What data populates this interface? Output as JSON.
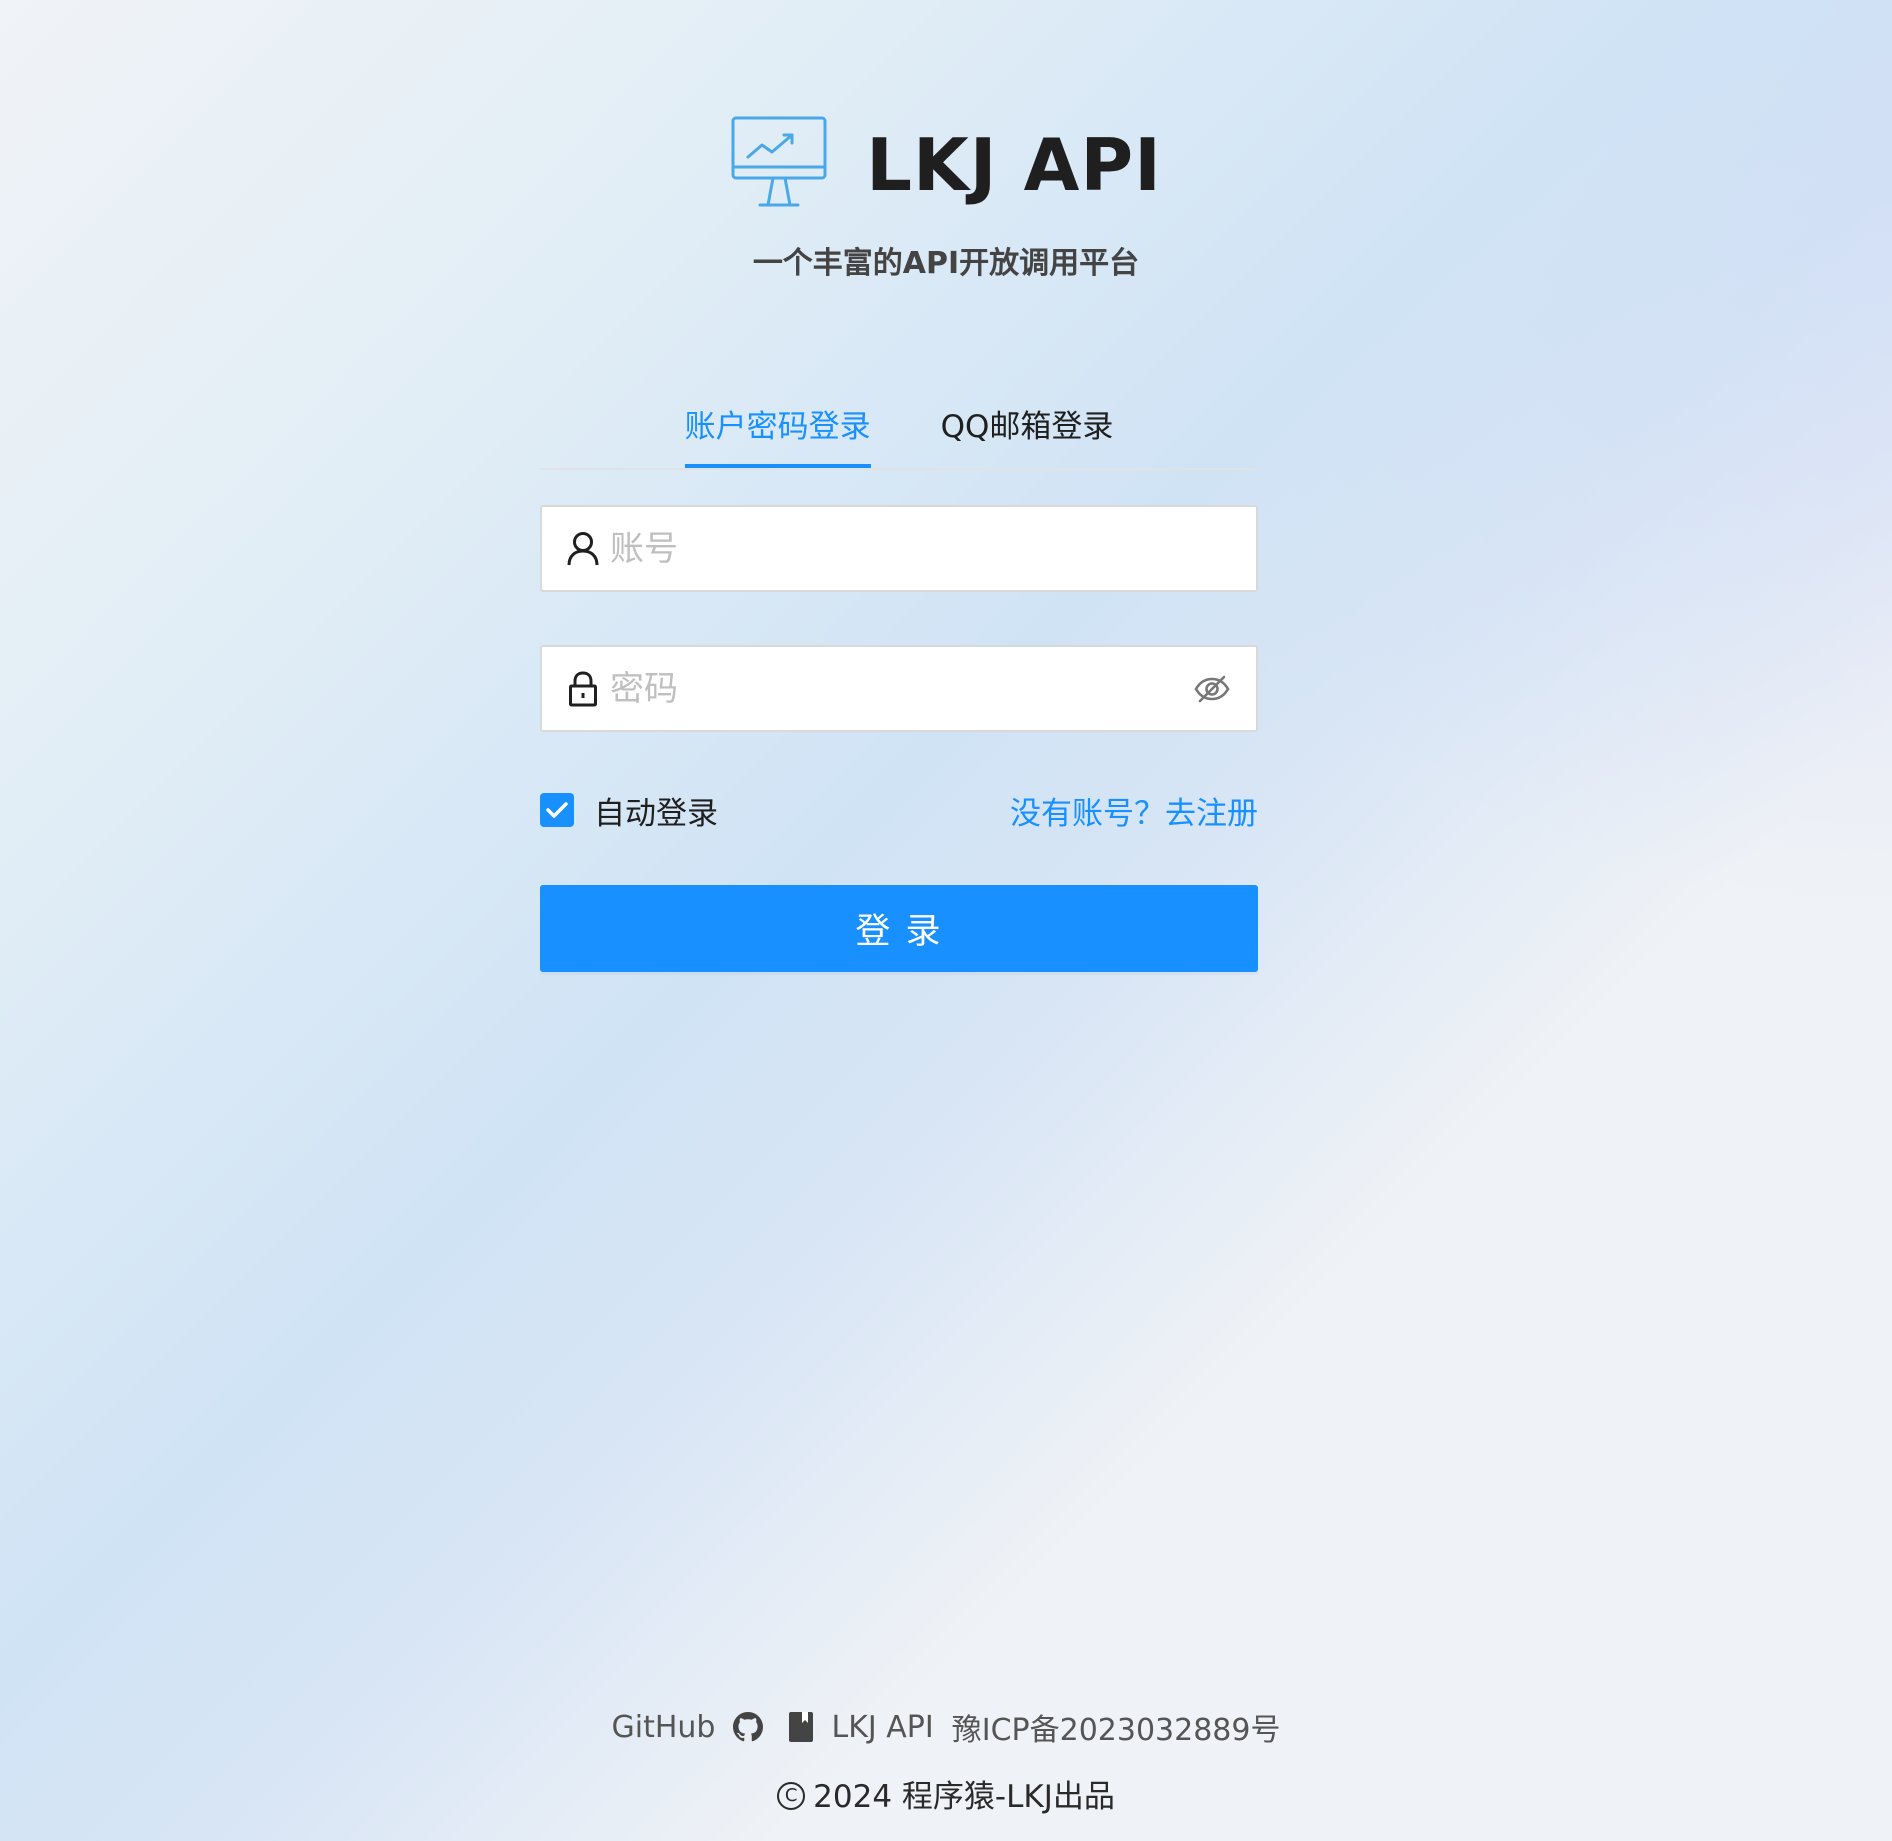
{
  "brand": {
    "title": "LKJ API",
    "subtitle": "一个丰富的API开放调用平台",
    "logo_icon": "monitor-chart-icon",
    "logo_color": "#4aa8e8"
  },
  "tabs": [
    {
      "label": "账户密码登录",
      "active": true
    },
    {
      "label": "QQ邮箱登录",
      "active": false
    }
  ],
  "form": {
    "account_placeholder": "账号",
    "account_value": "",
    "account_icon": "user-icon",
    "password_placeholder": "密码",
    "password_value": "",
    "password_icon": "lock-icon",
    "visibility_icon": "eye-invisible-icon",
    "remember_label": "自动登录",
    "remember_checked": true,
    "register_link": "没有账号？去注册",
    "submit_label": "登 录"
  },
  "footer": {
    "links": [
      {
        "label": "GitHub",
        "icon": "github-icon"
      },
      {
        "label": "LKJ API",
        "icon": "book-icon"
      },
      {
        "label": "豫ICP备2023032889号"
      }
    ],
    "copyright": "2024 程序猿-LKJ出品"
  },
  "colors": {
    "primary": "#1890ff",
    "background": "#eff2f6",
    "text": "#1f1f1f",
    "placeholder": "#bfbfbf",
    "border": "#d9d9d9"
  }
}
